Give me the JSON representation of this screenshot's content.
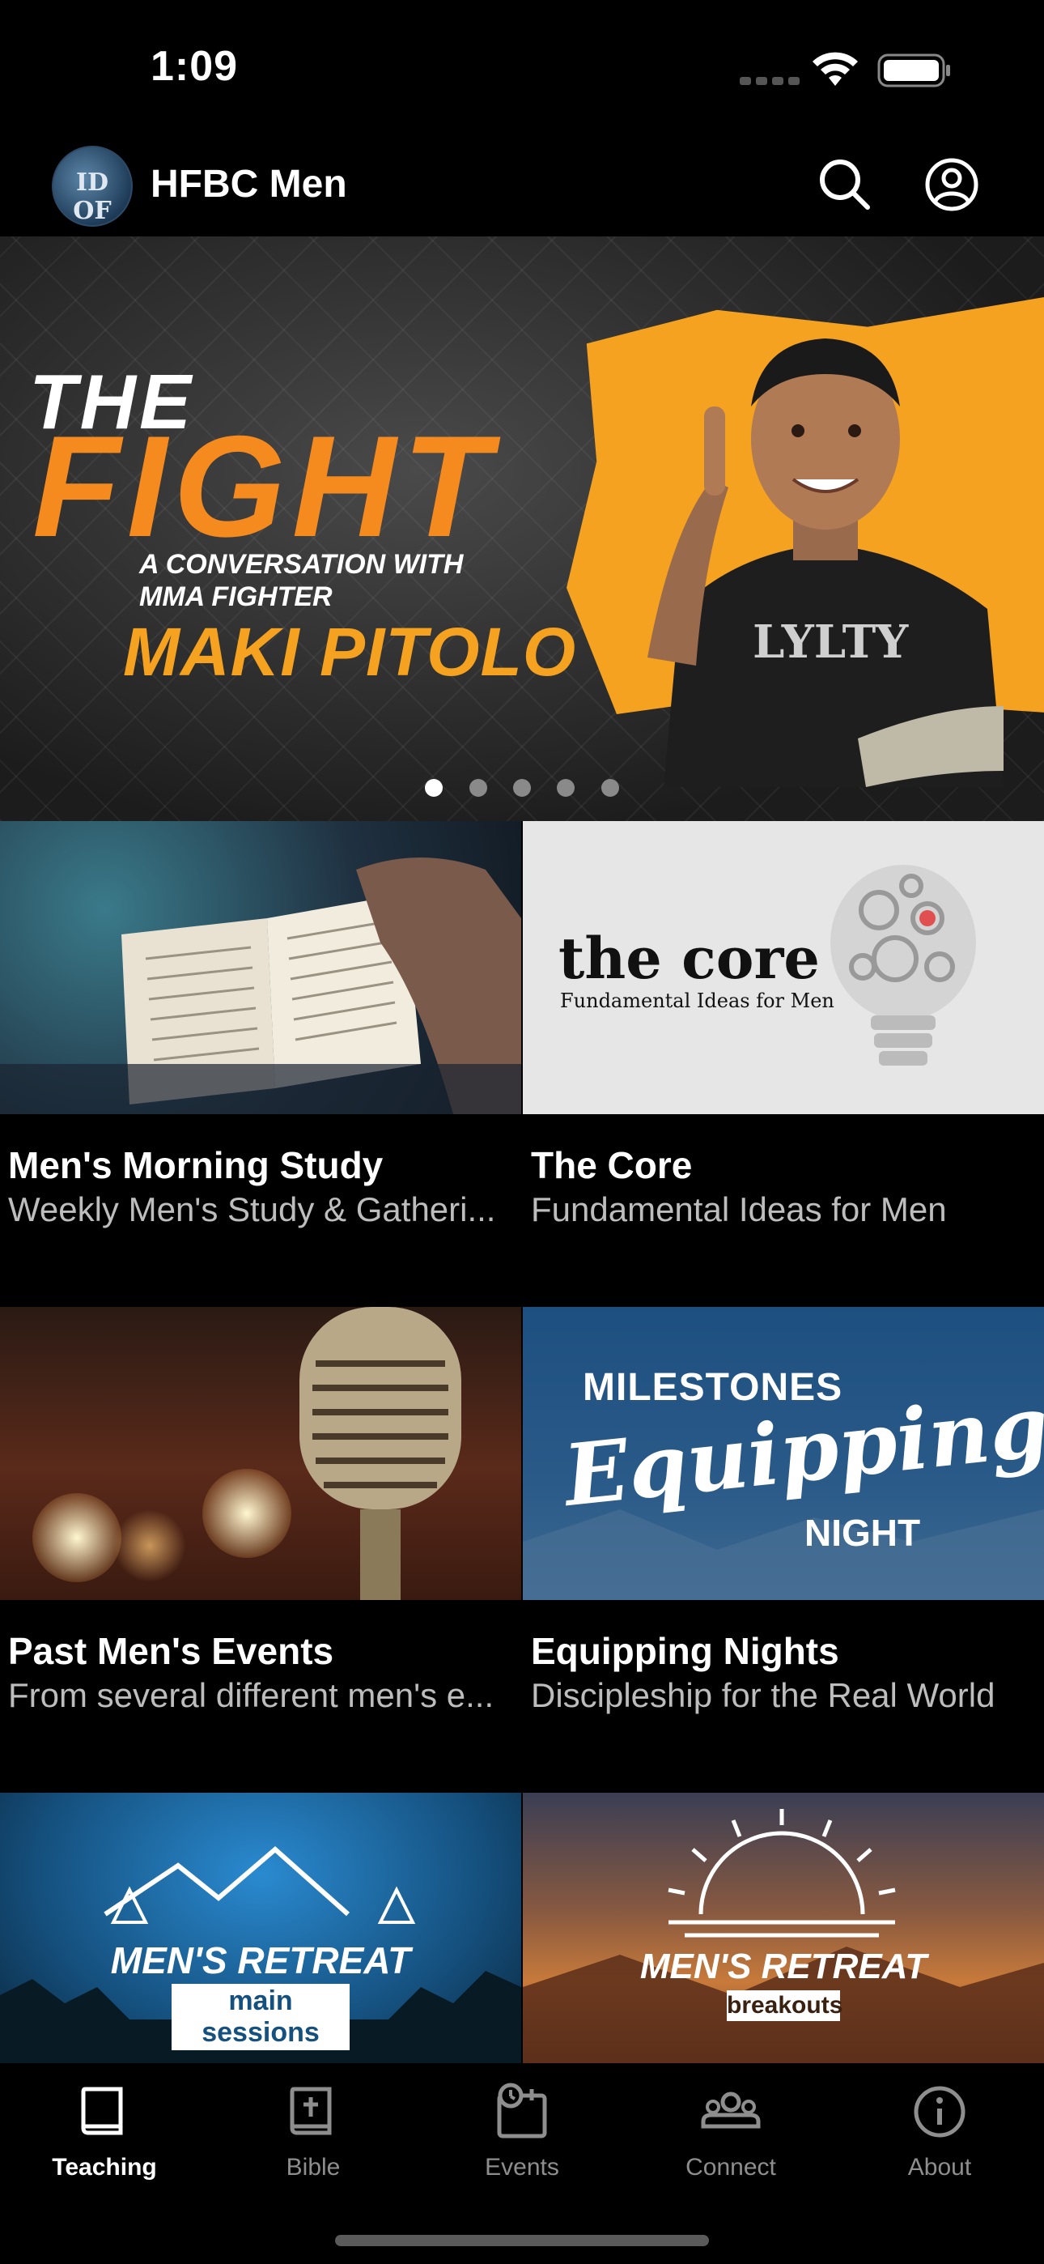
{
  "status": {
    "time": "1:09"
  },
  "header": {
    "title": "HFBC Men",
    "logo_text": "ID OF TF"
  },
  "hero": {
    "the": "THE",
    "fight": "FIGHT",
    "conversation": "A CONVERSATION WITH",
    "fighter": "MMA FIGHTER",
    "name": "MAKI PITOLO",
    "shirt_text": "LYLTY",
    "slide_count": 5,
    "active_slide": 1
  },
  "tiles": [
    {
      "title": "Men's Morning Study",
      "subtitle": "Weekly Men's Study & Gatheri..."
    },
    {
      "title": "The Core",
      "subtitle": "Fundamental Ideas for Men",
      "art_title": "the core",
      "art_subtitle": "Fundamental Ideas for Men"
    },
    {
      "title": "Past Men's Events",
      "subtitle": "From several different men's e..."
    },
    {
      "title": "Equipping Nights",
      "subtitle": "Discipleship for the Real World",
      "art_top": "MILESTONES",
      "art_script": "Equipping",
      "art_bottom": "NIGHT"
    },
    {
      "art_title": "MEN'S RETREAT",
      "art_sub": "main sessions"
    },
    {
      "art_title": "MEN'S RETREAT",
      "art_sub": "breakouts"
    }
  ],
  "tabs": [
    {
      "label": "Teaching",
      "icon": "book-icon",
      "active": true
    },
    {
      "label": "Bible",
      "icon": "bible-icon",
      "active": false
    },
    {
      "label": "Events",
      "icon": "calendar-icon",
      "active": false
    },
    {
      "label": "Connect",
      "icon": "people-icon",
      "active": false
    },
    {
      "label": "About",
      "icon": "info-icon",
      "active": false
    }
  ],
  "colors": {
    "accent_orange": "#f58a1f",
    "hero_gold": "#f4a21f",
    "inactive": "#8e8e8e"
  }
}
